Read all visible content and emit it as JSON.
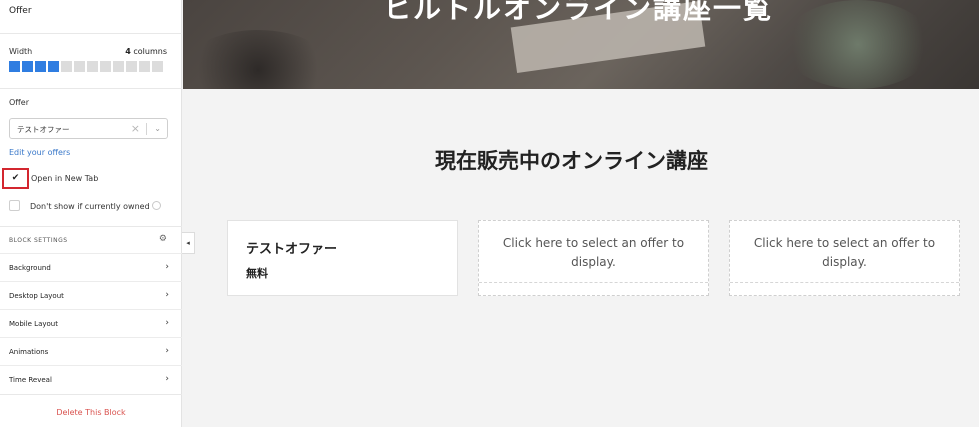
{
  "sidebar": {
    "title": "Offer",
    "width": {
      "label": "Width",
      "value_number": "4",
      "value_unit": "columns",
      "selected": 4,
      "total": 12
    },
    "offer": {
      "label": "Offer",
      "selected": "テストオファー",
      "clear": "×",
      "chevron": "⌄"
    },
    "edit_link": "Edit your offers",
    "open_new_tab": {
      "label": "Open in New Tab",
      "checked": true
    },
    "dont_show_owned": {
      "label": "Don't show if currently owned",
      "checked": false
    },
    "block_settings": "BLOCK SETTINGS",
    "menu": [
      "Background",
      "Desktop Layout",
      "Mobile Layout",
      "Animations",
      "Time Reveal"
    ],
    "delete": "Delete This Block",
    "collapse": "◂"
  },
  "hero": {
    "title": "ヒルトルオンライン講座一覧"
  },
  "main": {
    "section_title": "現在販売中のオンライン講座",
    "cards": [
      {
        "name": "テストオファー",
        "price": "無料"
      },
      {
        "placeholder": "Click here to select an offer to display."
      },
      {
        "placeholder": "Click here to select an offer to display."
      }
    ]
  },
  "colors": {
    "accent": "#2f7de1",
    "delete": "#d9534f",
    "link": "#3a78c9",
    "highlight": "#d3262f"
  },
  "icons": {
    "check": "checkmark-icon",
    "gear": "gear-icon",
    "chevron": "chevron-right-icon",
    "info": "info-icon"
  }
}
